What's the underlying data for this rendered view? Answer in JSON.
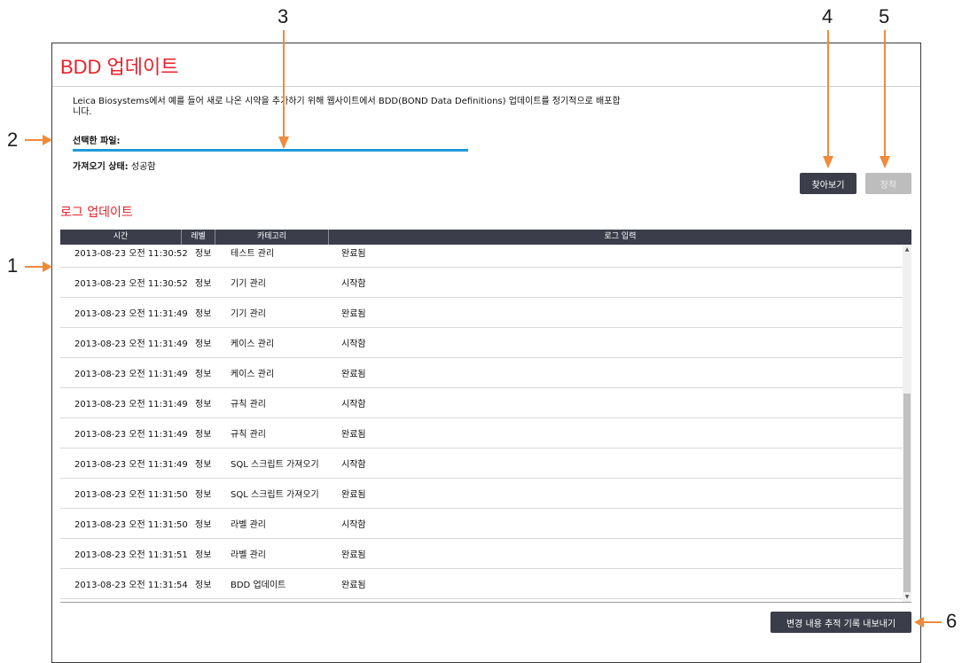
{
  "header": {
    "title": "BDD 업데이트"
  },
  "description": "Leica Biosystems에서 예를 들어 새로 나온 시약을 추가하기 위해 웹사이트에서 BDD(BOND Data Definitions) 업데이트를 정기적으로 배포합니다.",
  "selected_file": {
    "label": "선택한 파일:",
    "progress": 1.0
  },
  "import_status": {
    "label": "가져오기 상태:",
    "value": "성공함"
  },
  "buttons": {
    "browse": "찾아보기",
    "import": "장착",
    "export": "변경 내용 추적 기록 내보내기"
  },
  "log": {
    "title": "로그 업데이트",
    "columns": [
      "시간",
      "레벨",
      "카테고리",
      "로그 입력"
    ],
    "rows": [
      [
        "2013-08-23 오전 11:30:52",
        "정보",
        "테스트 관리",
        "완료됨"
      ],
      [
        "2013-08-23 오전 11:30:52",
        "정보",
        "기기 관리",
        "시작함"
      ],
      [
        "2013-08-23 오전 11:31:49",
        "정보",
        "기기 관리",
        "완료됨"
      ],
      [
        "2013-08-23 오전 11:31:49",
        "정보",
        "케이스 관리",
        "시작함"
      ],
      [
        "2013-08-23 오전 11:31:49",
        "정보",
        "케이스 관리",
        "완료됨"
      ],
      [
        "2013-08-23 오전 11:31:49",
        "정보",
        "규칙 관리",
        "시작함"
      ],
      [
        "2013-08-23 오전 11:31:49",
        "정보",
        "규칙 관리",
        "완료됨"
      ],
      [
        "2013-08-23 오전 11:31:49",
        "정보",
        "SQL 스크립트 가져오기",
        "시작함"
      ],
      [
        "2013-08-23 오전 11:31:50",
        "정보",
        "SQL 스크립트 가져오기",
        "완료됨"
      ],
      [
        "2013-08-23 오전 11:31:50",
        "정보",
        "라벨 관리",
        "시작함"
      ],
      [
        "2013-08-23 오전 11:31:51",
        "정보",
        "라벨 관리",
        "완료됨"
      ],
      [
        "2013-08-23 오전 11:31:54",
        "정보",
        "BDD 업데이트",
        "완료됨"
      ]
    ]
  },
  "callouts": [
    "1",
    "2",
    "3",
    "4",
    "5",
    "6"
  ],
  "colors": {
    "accent": "#e8202a",
    "dark_button": "#3b3d4a",
    "progress": "#1e9bd7",
    "callout_arrow": "#f08a3c"
  }
}
